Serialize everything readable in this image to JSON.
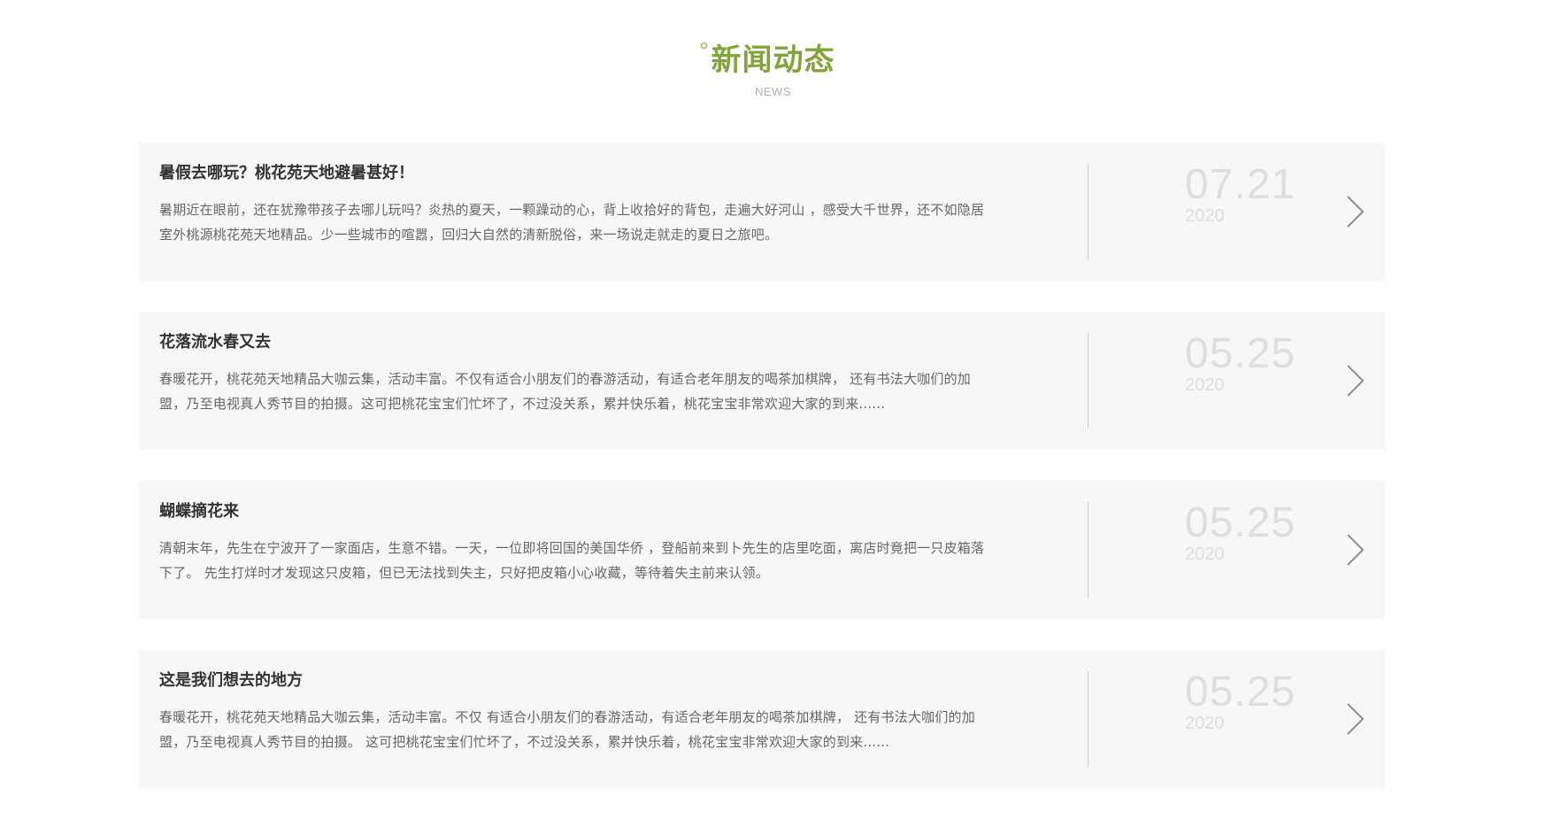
{
  "header": {
    "title": "新闻动态",
    "subtitle": "NEWS",
    "accent_color": "#7fa53b"
  },
  "news": [
    {
      "title": "暑假去哪玩？桃花苑天地避暑甚好！",
      "desc_line1": "暑期近在眼前，还在犹豫带孩子去哪儿玩吗？炎热的夏天，一颗躁动的心，背上收拾好的背包，走遍大好河山 ，感受大千世界，还不如隐居",
      "desc_line2": "室外桃源桃花苑天地精品。少一些城市的喧嚣，回归大自然的清新脱俗，来一场说走就走的夏日之旅吧。",
      "day": "07.21",
      "year": "2020",
      "icon": "chevron-right-icon"
    },
    {
      "title": "花落流水春又去",
      "desc_line1": "春暖花开，桃花苑天地精品大咖云集，活动丰富。不仅有适合小朋友们的春游活动，有适合老年朋友的喝茶加棋牌， 还有书法大咖们的加",
      "desc_line2": "盟，乃至电视真人秀节目的拍摄。这可把桃花宝宝们忙坏了，不过没关系，累并快乐着，桃花宝宝非常欢迎大家的到来......",
      "day": "05.25",
      "year": "2020",
      "icon": "chevron-right-icon"
    },
    {
      "title": "蝴蝶摘花来",
      "desc_line1": "清朝末年，先生在宁波开了一家面店，生意不错。一天，一位即将回国的美国华侨 ，登船前来到卜先生的店里吃面，离店时竟把一只皮箱落",
      "desc_line2": "下了。 先生打烊时才发现这只皮箱，但已无法找到失主，只好把皮箱小心收藏，等待着失主前来认领。",
      "day": "05.25",
      "year": "2020",
      "icon": "chevron-right-icon"
    },
    {
      "title": "这是我们想去的地方",
      "desc_line1": "春暖花开，桃花苑天地精品大咖云集，活动丰富。不仅 有适合小朋友们的春游活动，有适合老年朋友的喝茶加棋牌， 还有书法大咖们的加",
      "desc_line2": "盟，乃至电视真人秀节目的拍摄。 这可把桃花宝宝们忙坏了，不过没关系，累并快乐着，桃花宝宝非常欢迎大家的到来......",
      "day": "05.25",
      "year": "2020",
      "icon": "chevron-right-icon"
    }
  ]
}
